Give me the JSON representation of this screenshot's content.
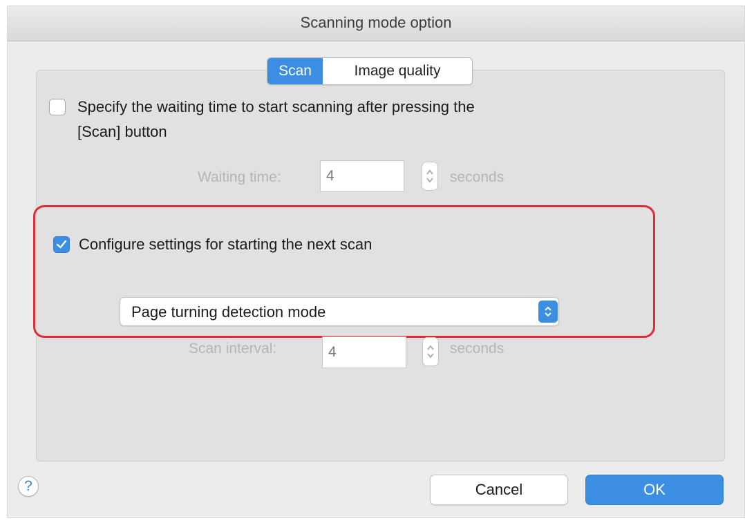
{
  "window": {
    "title": "Scanning mode option"
  },
  "tabs": [
    {
      "label": "Scan",
      "active": true
    },
    {
      "label": "Image quality",
      "active": false
    }
  ],
  "waiting_option": {
    "checked": false,
    "label_line1": "Specify the waiting time to start scanning after pressing the",
    "label_line2": "[Scan] button",
    "field_label": "Waiting time:",
    "value": "4",
    "unit": "seconds"
  },
  "next_scan_option": {
    "checked": true,
    "label": "Configure settings for starting the next scan",
    "mode_selected": "Page turning detection mode",
    "interval_label": "Scan interval:",
    "interval_value": "4",
    "interval_unit": "seconds"
  },
  "footer": {
    "help_label": "?",
    "cancel_label": "Cancel",
    "ok_label": "OK"
  },
  "colors": {
    "accent": "#3b8ee1",
    "highlight": "#e22a35"
  },
  "icons": {
    "checkmark": "checkmark-icon",
    "stepper": "stepper-arrows-icon",
    "popup_arrow": "popup-chevrons-icon",
    "help": "help-icon"
  }
}
